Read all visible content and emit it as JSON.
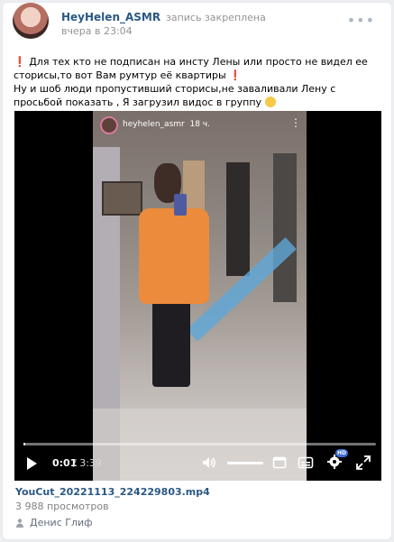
{
  "header": {
    "author": "HeyHelen_ASMR",
    "pinned_label": "запись закреплена",
    "time": "вчера в 23:04",
    "menu_icon": "more-horizontal-icon"
  },
  "post": {
    "line1": "Для тех кто не подписан на инсту Лены или просто не видел ее сторисы,то вот Вам румтур её квартиры",
    "line2": "Ну и шоб люди пропустивший сторисы,не заваливали Лену с просьбой показать , Я загрузил видос в группу",
    "excl_mark": "❗"
  },
  "video": {
    "story_user": "heyhelen_asmr",
    "story_age": "18 ч.",
    "current_time": "0:01",
    "total_time": "/ 3:39",
    "progress": 0.005,
    "quality_badge": "HD",
    "accent_color": "#2a5885"
  },
  "attachment": {
    "file_title": "YouCut_20221113_224229803.mp4",
    "views": "3 988 просмотров",
    "owner": "Денис Глиф"
  }
}
